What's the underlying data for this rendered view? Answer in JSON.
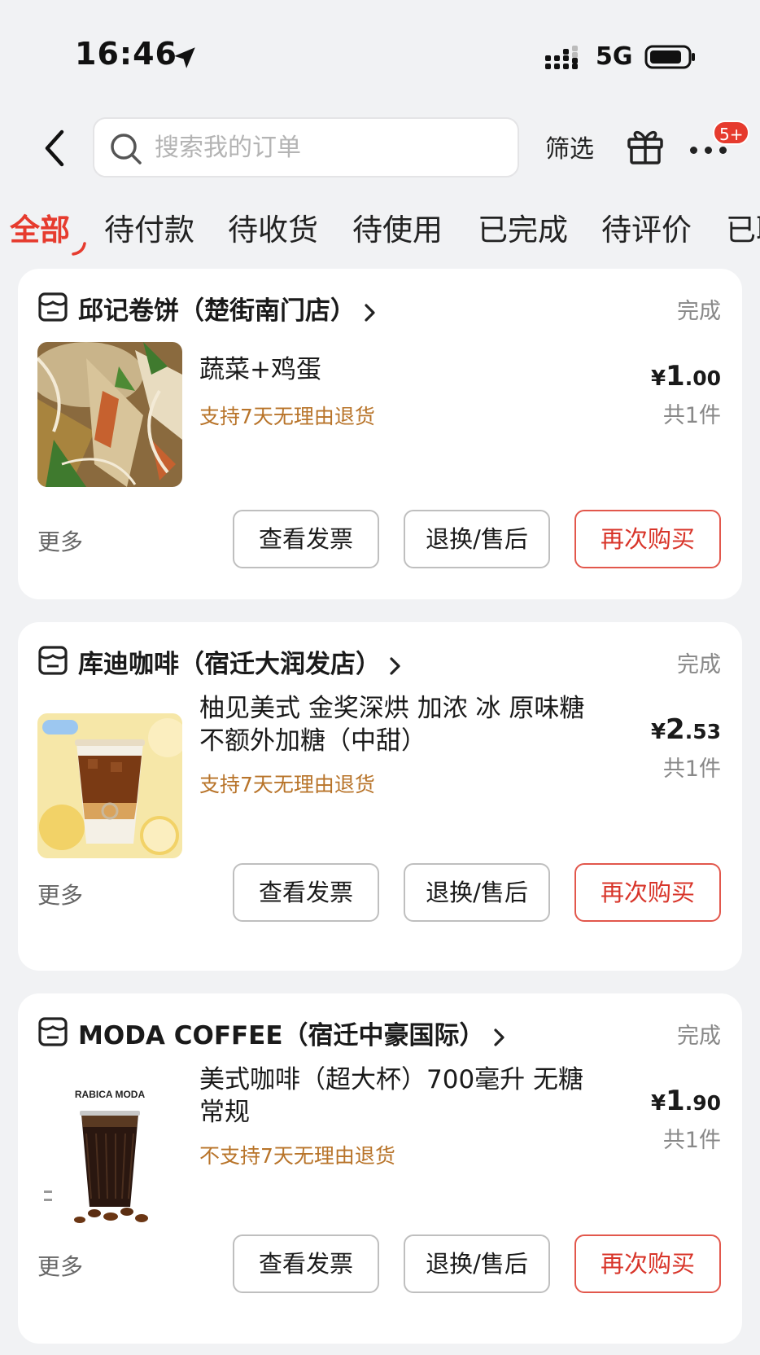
{
  "status_bar": {
    "time": "16:46",
    "network": "5G",
    "icons": [
      "location-arrow-icon",
      "signal-icon",
      "battery-icon"
    ]
  },
  "header": {
    "search_placeholder": "搜索我的订单",
    "filter_label": "筛选",
    "more_badge": "5+"
  },
  "tabs": [
    {
      "label": "全部",
      "active": true
    },
    {
      "label": "待付款"
    },
    {
      "label": "待收货"
    },
    {
      "label": "待使用"
    },
    {
      "label": "已完成"
    },
    {
      "label": "待评价"
    },
    {
      "label": "已取消"
    }
  ],
  "orders": [
    {
      "store": "邱记卷饼（楚街南门店）",
      "status": "完成",
      "item": "蔬菜+鸡蛋",
      "policy": "支持7天无理由退货",
      "price_currency": "¥",
      "price_int": "1",
      "price_dec": ".00",
      "quantity": "共1件",
      "more": "更多",
      "buttons": [
        "查看发票",
        "退换/售后",
        "再次购买"
      ]
    },
    {
      "store": "库迪咖啡（宿迁大润发店）",
      "status": "完成",
      "item": "柚见美式 金奖深烘 加浓 冰 原味糖 不额外加糖（中甜）",
      "policy": "支持7天无理由退货",
      "price_currency": "¥",
      "price_int": "2",
      "price_dec": ".53",
      "quantity": "共1件",
      "more": "更多",
      "buttons": [
        "查看发票",
        "退换/售后",
        "再次购买"
      ]
    },
    {
      "store": "MODA COFFEE（宿迁中豪国际）",
      "status": "完成",
      "item": "美式咖啡（超大杯）700毫升 无糖 常规",
      "policy": "不支持7天无理由退货",
      "price_currency": "¥",
      "price_int": "1",
      "price_dec": ".90",
      "quantity": "共1件",
      "more": "更多",
      "buttons": [
        "查看发票",
        "退换/售后",
        "再次购买"
      ],
      "thumb_brand": "RABICA MODA"
    }
  ],
  "colors": {
    "accent": "#e63b2e",
    "policy": "#b8742a",
    "background": "#f1f2f4"
  }
}
